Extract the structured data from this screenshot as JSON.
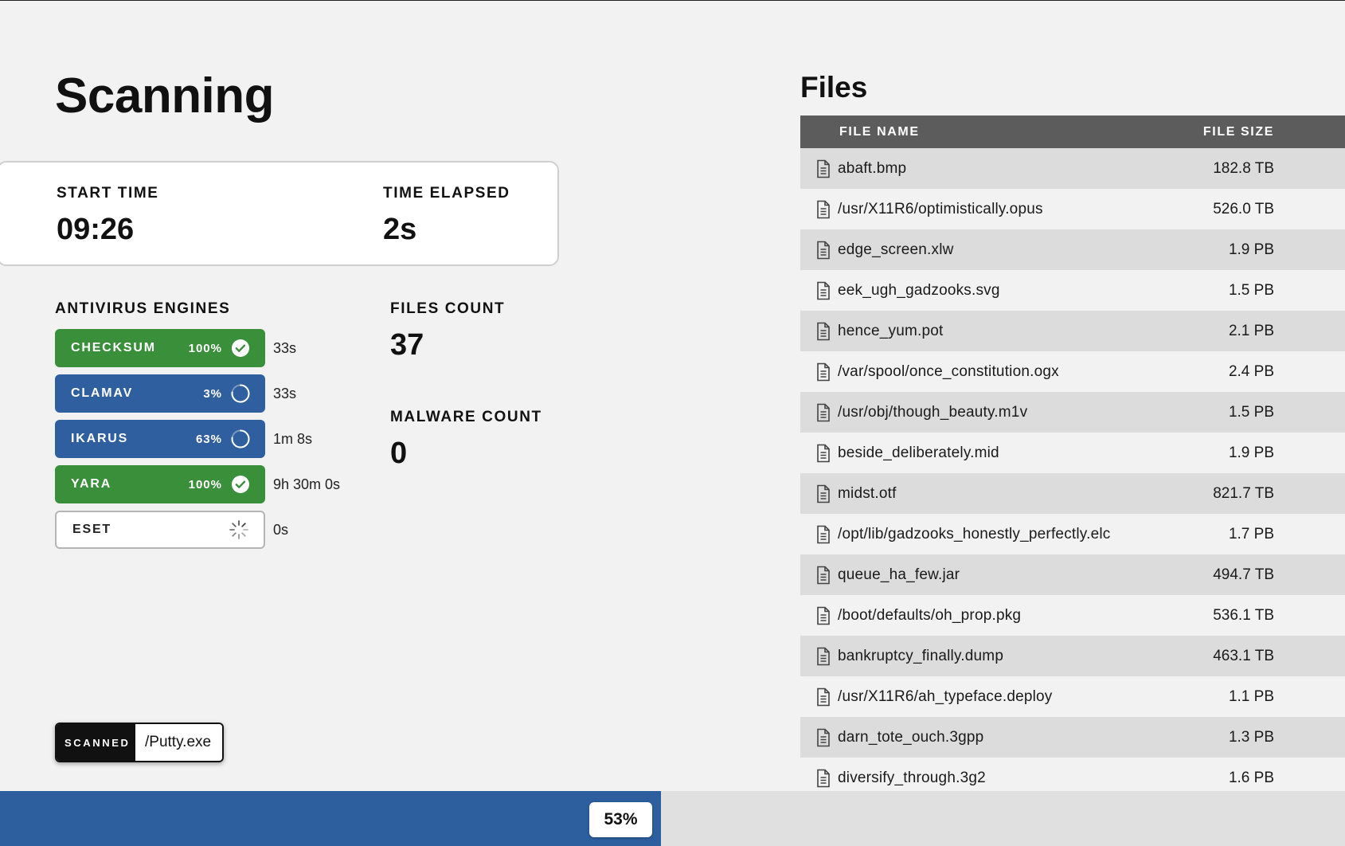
{
  "page": {
    "title": "Scanning"
  },
  "times": {
    "start_label": "START TIME",
    "start_value": "09:26",
    "elapsed_label": "TIME ELAPSED",
    "elapsed_value": "2s"
  },
  "engines_label": "ANTIVIRUS ENGINES",
  "engines": [
    {
      "name": "CHECKSUM",
      "percent": "100%",
      "status": "done",
      "icon": "check-circle-icon",
      "time": "33s"
    },
    {
      "name": "CLAMAV",
      "percent": "3%",
      "status": "running",
      "icon": "spinner-ring-icon",
      "time": "33s"
    },
    {
      "name": "IKARUS",
      "percent": "63%",
      "status": "running",
      "icon": "spinner-ring-icon",
      "time": "1m 8s"
    },
    {
      "name": "YARA",
      "percent": "100%",
      "status": "done",
      "icon": "check-circle-icon",
      "time": "9h 30m 0s"
    },
    {
      "name": "ESET",
      "percent": "",
      "status": "queued",
      "icon": "loading-dots-icon",
      "time": "0s"
    }
  ],
  "counts": {
    "files_label": "FILES COUNT",
    "files_value": "37",
    "malware_label": "MALWARE COUNT",
    "malware_value": "0"
  },
  "scanned": {
    "tag": "SCANNED",
    "file": "/Putty.exe"
  },
  "progress": {
    "value": 0.53,
    "label": "53%"
  },
  "files": {
    "title": "Files",
    "headers": {
      "name": "FILE NAME",
      "size": "FILE SIZE"
    },
    "rows": [
      {
        "name": "abaft.bmp",
        "size": "182.8 TB"
      },
      {
        "name": "/usr/X11R6/optimistically.opus",
        "size": "526.0 TB"
      },
      {
        "name": "edge_screen.xlw",
        "size": "1.9 PB"
      },
      {
        "name": "eek_ugh_gadzooks.svg",
        "size": "1.5 PB"
      },
      {
        "name": "hence_yum.pot",
        "size": "2.1 PB"
      },
      {
        "name": "/var/spool/once_constitution.ogx",
        "size": "2.4 PB"
      },
      {
        "name": "/usr/obj/though_beauty.m1v",
        "size": "1.5 PB"
      },
      {
        "name": "beside_deliberately.mid",
        "size": "1.9 PB"
      },
      {
        "name": "midst.otf",
        "size": "821.7 TB"
      },
      {
        "name": "/opt/lib/gadzooks_honestly_perfectly.elc",
        "size": "1.7 PB"
      },
      {
        "name": "queue_ha_few.jar",
        "size": "494.7 TB"
      },
      {
        "name": "/boot/defaults/oh_prop.pkg",
        "size": "536.1 TB"
      },
      {
        "name": "bankruptcy_finally.dump",
        "size": "463.1 TB"
      },
      {
        "name": "/usr/X11R6/ah_typeface.deploy",
        "size": "1.1 PB"
      },
      {
        "name": "darn_tote_ouch.3gpp",
        "size": "1.3 PB"
      },
      {
        "name": "diversify_through.3g2",
        "size": "1.6 PB"
      }
    ]
  },
  "colors": {
    "done": "#3a8f3a",
    "running": "#2f5f9f",
    "progress": "#2d5f9f",
    "table_header": "#5c5c5c"
  }
}
